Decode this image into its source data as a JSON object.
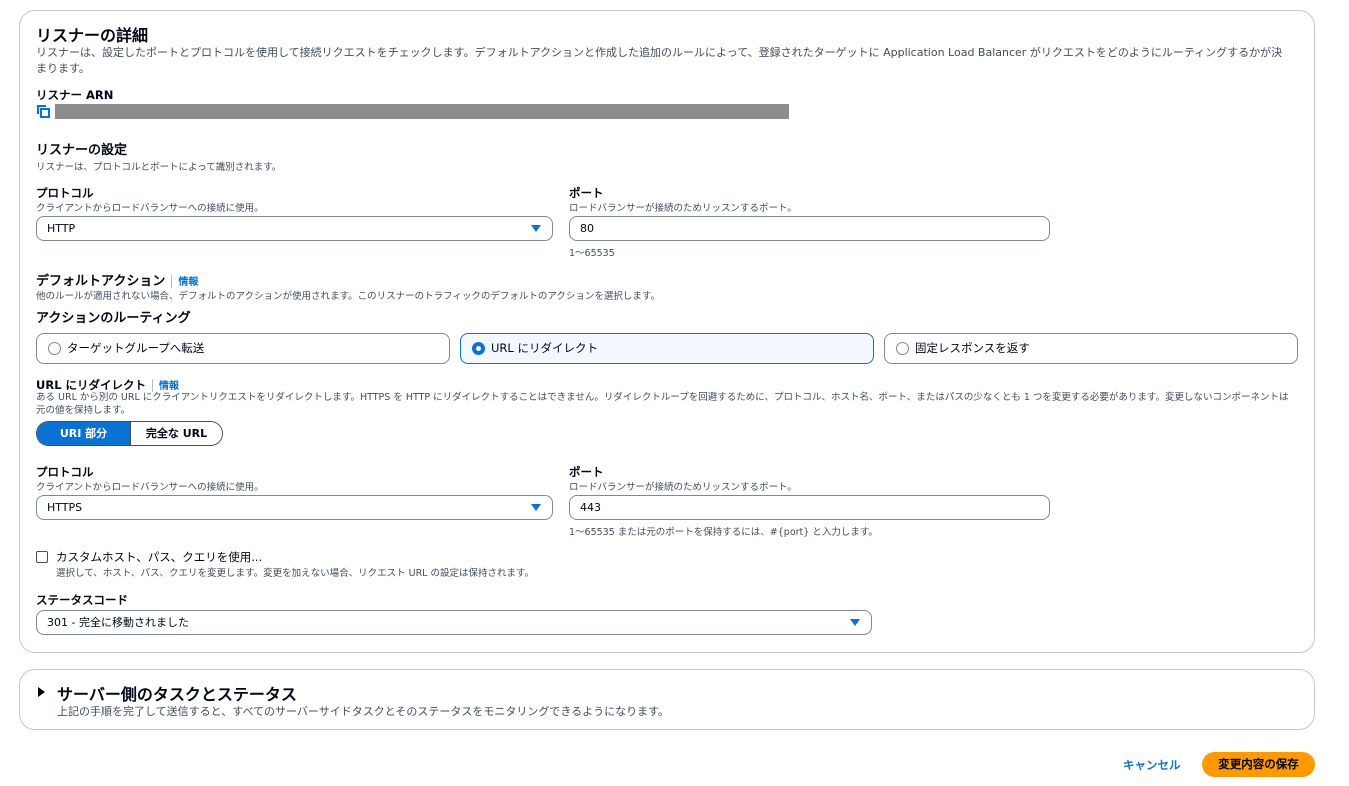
{
  "listener_details": {
    "title": "リスナーの詳細",
    "description": "リスナーは、設定したポートとプロトコルを使用して接続リクエストをチェックします。デフォルトアクションと作成した追加のルールによって、登録されたターゲットに Application Load Balancer がリクエストをどのようにルーティングするかが決まります。",
    "description_line1": "リスナーは、設定したポートとプロトコルを使用して接続リクエストをチェックします。デフォルトアクションと作成した追加のルールによって、登録されたターゲットに Application Load Balancer がリクエストをどのようにルーティングするかが決",
    "description_line2": "まります。",
    "arn_label": "リスナー ARN"
  },
  "listener_settings": {
    "title": "リスナーの設定",
    "description": "リスナーは、プロトコルとポートによって識別されます。",
    "protocol_label": "プロトコル",
    "protocol_desc": "クライアントからロードバランサーへの接続に使用。",
    "protocol_value": "HTTP",
    "port_label": "ポート",
    "port_desc": "ロードバランサーが接続のためリッスンするポート。",
    "port_value": "80",
    "port_hint": "1〜65535"
  },
  "default_action": {
    "title": "デフォルトアクション",
    "info": "情報",
    "description": "他のルールが適用されない場合、デフォルトのアクションが使用されます。このリスナーのトラフィックのデフォルトのアクションを選択します。",
    "routing_label": "アクションのルーティング",
    "options": [
      {
        "label": "ターゲットグループへ転送",
        "selected": false
      },
      {
        "label": "URL にリダイレクト",
        "selected": true
      },
      {
        "label": "固定レスポンスを返す",
        "selected": false
      }
    ]
  },
  "redirect": {
    "title": "URL にリダイレクト",
    "info": "情報",
    "description_line1": "ある URL から別の URL にクライアントリクエストをリダイレクトします。HTTPS を HTTP にリダイレクトすることはできません。リダイレクトループを回避するために、プロトコル、ホスト名、ポート、またはパスの少なくとも 1 つを変更する必要があります。変更しないコンポーネントは",
    "description_line2": "元の値を保持します。",
    "segments": [
      "URI 部分",
      "完全な URL"
    ],
    "protocol_label": "プロトコル",
    "protocol_desc": "クライアントからロードバランサーへの接続に使用。",
    "protocol_value": "HTTPS",
    "port_label": "ポート",
    "port_desc": "ロードバランサーが接続のためリッスンするポート。",
    "port_value": "443",
    "port_hint": "1〜65535 または元のポートを保持するには、#{port} と入力します。",
    "custom_label": "カスタムホスト、パス、クエリを使用...",
    "custom_desc": "選択して、ホスト、パス、クエリを変更します。変更を加えない場合、リクエスト URL の設定は保持されます。",
    "custom_checked": false,
    "status_label": "ステータスコード",
    "status_value": "301 - 完全に移動されました"
  },
  "server_tasks": {
    "title": "サーバー側のタスクとステータス",
    "description": "上記の手順を完了して送信すると、すべてのサーバーサイドタスクとそのステータスをモニタリングできるようになります。"
  },
  "footer": {
    "cancel": "キャンセル",
    "save": "変更内容の保存"
  },
  "colors": {
    "accent": "#0972d3",
    "primary_button": "#ff9900",
    "border": "#7d8998"
  }
}
